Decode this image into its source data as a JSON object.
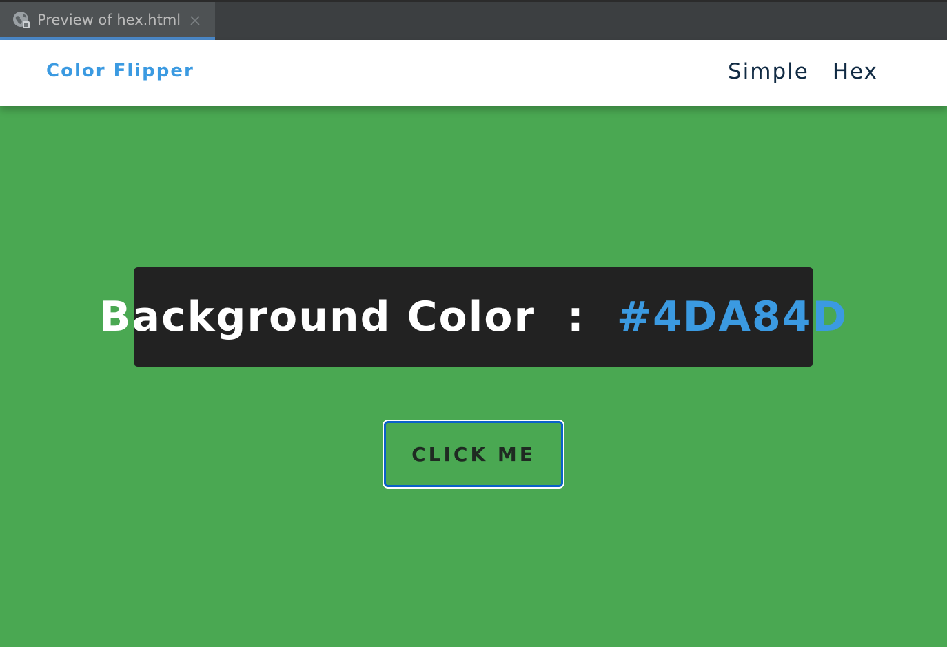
{
  "ide": {
    "tab_title": "Preview of hex.html",
    "tab_icon": "globe-icon",
    "close_icon": "close-icon"
  },
  "navbar": {
    "brand": "Color Flipper",
    "links": [
      {
        "label": "Simple"
      },
      {
        "label": "Hex"
      }
    ]
  },
  "main": {
    "label": "Background Color",
    "separator": ":",
    "color_value": "#4DA84D",
    "button_label": "CLICK ME"
  },
  "colors": {
    "background": "#4DA84D",
    "brand": "#3B9AE1",
    "box": "#222222",
    "button_border": "#0B61C9"
  }
}
